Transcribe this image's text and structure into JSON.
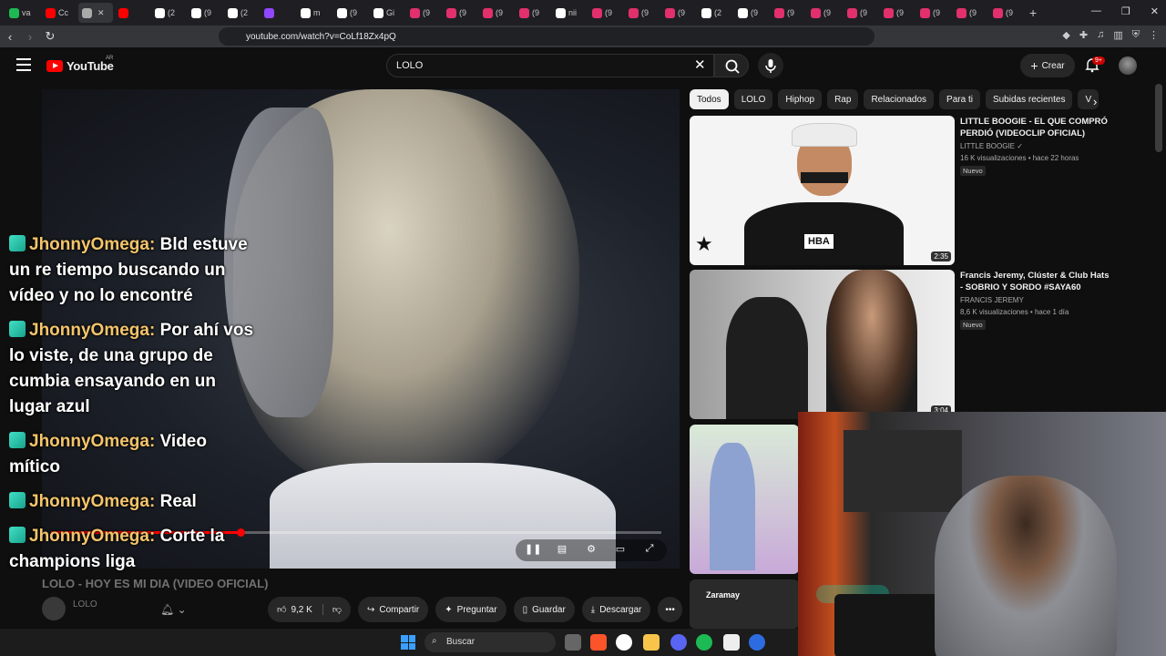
{
  "browser": {
    "tabs": [
      {
        "label": "va",
        "color": "#1fb954"
      },
      {
        "label": "Cc",
        "color": "#ff0000"
      },
      {
        "label": "",
        "color": "#aaaaaa",
        "active": true
      },
      {
        "label": "",
        "color": "#ff0000"
      },
      {
        "label": "(2",
        "color": "#ffffff"
      },
      {
        "label": "(9",
        "color": "#ffffff"
      },
      {
        "label": "(2",
        "color": "#ffffff"
      },
      {
        "label": "",
        "color": "#9146ff"
      },
      {
        "label": "m",
        "color": "#ffffff"
      },
      {
        "label": "(9",
        "color": "#ffffff"
      },
      {
        "label": "Gi",
        "color": "#ffffff"
      },
      {
        "label": "(9",
        "color": "#e1306c"
      },
      {
        "label": "(9",
        "color": "#e1306c"
      },
      {
        "label": "(9",
        "color": "#e1306c"
      },
      {
        "label": "(9",
        "color": "#e1306c"
      },
      {
        "label": "nii",
        "color": "#ffffff"
      },
      {
        "label": "(9",
        "color": "#e1306c"
      },
      {
        "label": "(9",
        "color": "#e1306c"
      },
      {
        "label": "(9",
        "color": "#e1306c"
      },
      {
        "label": "(2",
        "color": "#ffffff"
      },
      {
        "label": "(9",
        "color": "#ffffff"
      },
      {
        "label": "(9",
        "color": "#e1306c"
      },
      {
        "label": "(9",
        "color": "#e1306c"
      },
      {
        "label": "(9",
        "color": "#e1306c"
      },
      {
        "label": "(9",
        "color": "#e1306c"
      },
      {
        "label": "(9",
        "color": "#e1306c"
      },
      {
        "label": "(9",
        "color": "#e1306c"
      },
      {
        "label": "(9",
        "color": "#e1306c"
      }
    ],
    "new_tab": "+",
    "url": "youtube.com/watch?v=CoLf18Zx4pQ"
  },
  "header": {
    "logo_text": "YouTube",
    "country": "AR",
    "search_value": "LOLO",
    "create_label": "Crear",
    "notifications_badge": "9+"
  },
  "player": {
    "progress_fraction": 0.31
  },
  "chat": [
    {
      "user": "JhonnyOmega:",
      "text": "Bld estuve un re tiempo buscando un vídeo y no lo encontré"
    },
    {
      "user": "JhonnyOmega:",
      "text": "Por ahí vos lo viste, de una grupo de cumbia ensayando en un lugar azul"
    },
    {
      "user": "JhonnyOmega:",
      "text": "Video mítico"
    },
    {
      "user": "JhonnyOmega:",
      "text": "Real"
    },
    {
      "user": "JhonnyOmega:",
      "text": "Corte la champions liga"
    }
  ],
  "video": {
    "title": "LOLO - HOY ES MI DIA (VIDEO OFICIAL)",
    "channel": "LOLO",
    "likes": "9,2 K",
    "share_label": "Compartir",
    "ask_label": "Preguntar",
    "save_label": "Guardar",
    "download_label": "Descargar",
    "more_label": "•••"
  },
  "chips": [
    "Todos",
    "LOLO",
    "Hiphop",
    "Rap",
    "Relacionados",
    "Para ti",
    "Subidas recientes",
    "V"
  ],
  "recommendations": [
    {
      "title": "LITTLE BOOGIE - EL QUE COMPRÓ PERDIÓ (VIDEOCLIP OFICIAL)",
      "channel": "LITTLE BOOGIE",
      "meta": "16 K visualizaciones • hace 22 horas",
      "badge": "Nuevo",
      "duration": "2:35",
      "shirt_text": "HBA"
    },
    {
      "title": "Francis Jeremy, Clúster & Club Hats - SOBRIO Y SORDO #SAYA60",
      "channel": "FRANCIS JEREMY",
      "meta": "8,6 K visualizaciones • hace 1 día",
      "badge": "Nuevo",
      "duration": "3:04"
    }
  ],
  "rec4_text": "Zaramay",
  "taskbar": {
    "search_label": "Buscar"
  },
  "colors": {
    "accent": "#ff0000",
    "chat_user": "#f5c56b",
    "background": "#0f0f0f"
  }
}
